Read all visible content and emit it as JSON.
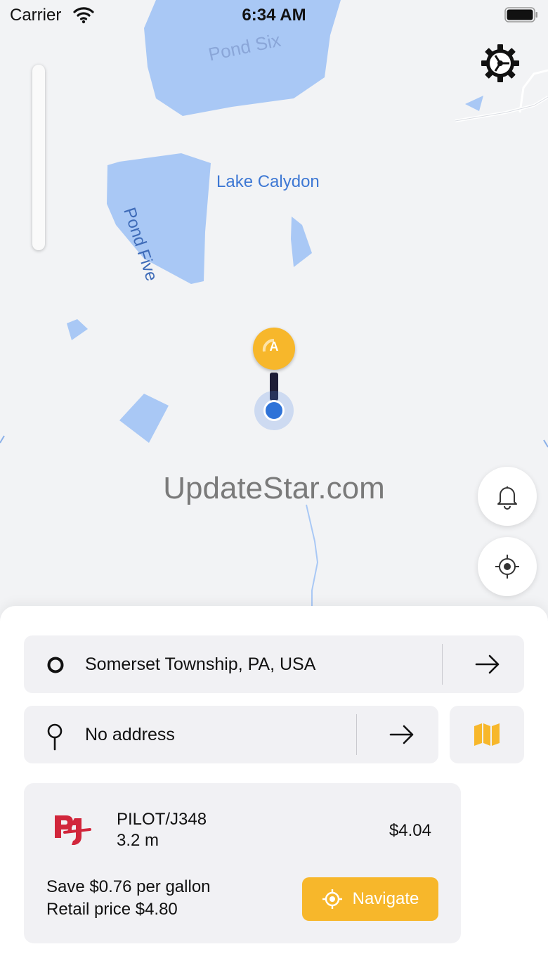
{
  "status_bar": {
    "carrier": "Carrier",
    "time": "6:34 AM",
    "icons": [
      "wifi-icon",
      "battery-icon"
    ]
  },
  "map": {
    "labels": {
      "pond_six": "Pond Six",
      "lake": "Lake Calydon",
      "pond_five": "Pond Five"
    },
    "watermark": "UpdateStar.com",
    "marker_letter": "A",
    "icons": [
      "gear-icon",
      "bell-icon",
      "crosshair-icon"
    ]
  },
  "route": {
    "origin": "Somerset Township, PA, USA",
    "destination": "No address"
  },
  "station": {
    "name": "PILOT/J348",
    "distance": "3.2 m",
    "price": "$4.04",
    "savings": "Save $0.76 per gallon",
    "retail": "Retail price $4.80",
    "navigate_label": "Navigate"
  },
  "colors": {
    "accent": "#f7b72b",
    "water": "#a9c8f5",
    "location": "#2f73d8",
    "logo_red": "#d1263b"
  }
}
